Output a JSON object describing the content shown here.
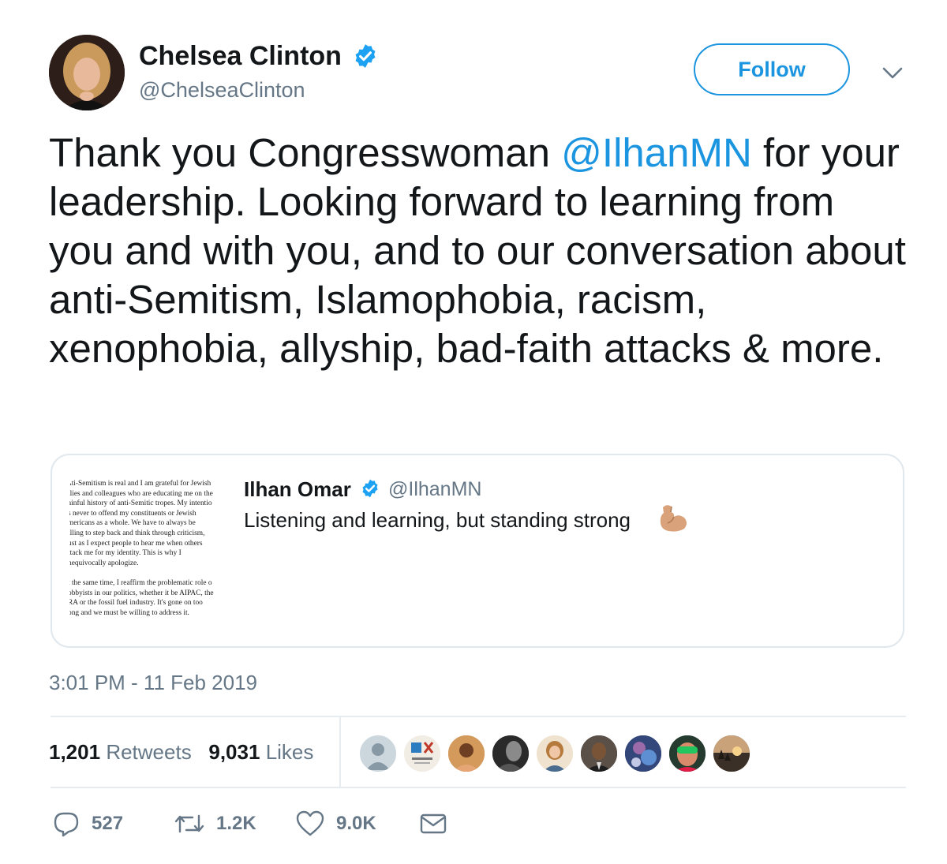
{
  "user": {
    "display_name": "Chelsea Clinton",
    "handle": "@ChelseaClinton",
    "avatar_icon": "profile-photo",
    "verified": true
  },
  "follow_label": "Follow",
  "tweet": {
    "text_before": "Thank you Congresswoman ",
    "mention": "@IlhanMN",
    "text_after": " for your leadership. Looking forward to learning from you and with you, and to our conversation about anti-Semitism, Islamophobia, racism, xenophobia, allyship, bad-faith attacks & more."
  },
  "quoted": {
    "name": "Ilhan Omar",
    "handle": "@IlhanMN",
    "text": "Listening and learning, but standing strong",
    "emoji_icon": "flexed-biceps-icon",
    "image_text": "nti-Semitism is real and I am grateful for Jewish\nllies and colleagues who are educating me on the\nainful history of anti-Semitic tropes. My intentio\ns never to offend my constituents or Jewish\nmericans as a whole. We have to always be\nilling to step back and think through criticism,\nust as I expect people to hear me when others\nttack me for my identity. This is why I\nnequivocally apologize.\n\nt the same time, I reaffirm the problematic role o\nobbyists in our politics, whether it be AIPAC, the\nRA or the fossil fuel industry. It's gone on too\nong and we must be willing to address it."
  },
  "timestamp": "3:01 PM - 11 Feb 2019",
  "stats": {
    "retweets_count": "1,201",
    "retweets_label": "Retweets",
    "likes_count": "9,031",
    "likes_label": "Likes"
  },
  "likers": [
    "default-avatar",
    "wx-logo",
    "person",
    "person-bw",
    "person",
    "person",
    "person",
    "person-goggles",
    "sunset"
  ],
  "actions": {
    "reply_count": "527",
    "retweet_count": "1.2K",
    "like_count": "9.0K"
  },
  "colors": {
    "accent": "#1b95e0",
    "muted": "#657786",
    "text": "#14171a",
    "border": "#e1e8ed"
  }
}
